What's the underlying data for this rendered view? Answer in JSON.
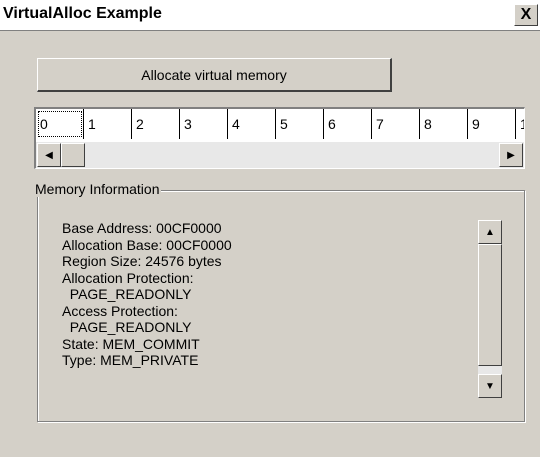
{
  "window": {
    "title": "VirtualAlloc Example",
    "close_label": "X"
  },
  "toolbar": {
    "allocate_label": "Allocate virtual memory"
  },
  "memory_map": {
    "cells": [
      "0",
      "1",
      "2",
      "3",
      "4",
      "5",
      "6",
      "7",
      "8",
      "9",
      "1"
    ]
  },
  "memory_info": {
    "group_label": "Memory Information",
    "lines": [
      "Base Address: 00CF0000",
      "Allocation Base: 00CF0000",
      "Region Size: 24576 bytes",
      "Allocation Protection:",
      "  PAGE_READONLY",
      "Access Protection:",
      "  PAGE_READONLY",
      "State: MEM_COMMIT",
      "Type: MEM_PRIVATE"
    ]
  },
  "icons": {
    "close": "close-icon",
    "left": "arrow-left-icon",
    "right": "arrow-right-icon",
    "up": "arrow-up-icon",
    "down": "arrow-down-icon"
  }
}
